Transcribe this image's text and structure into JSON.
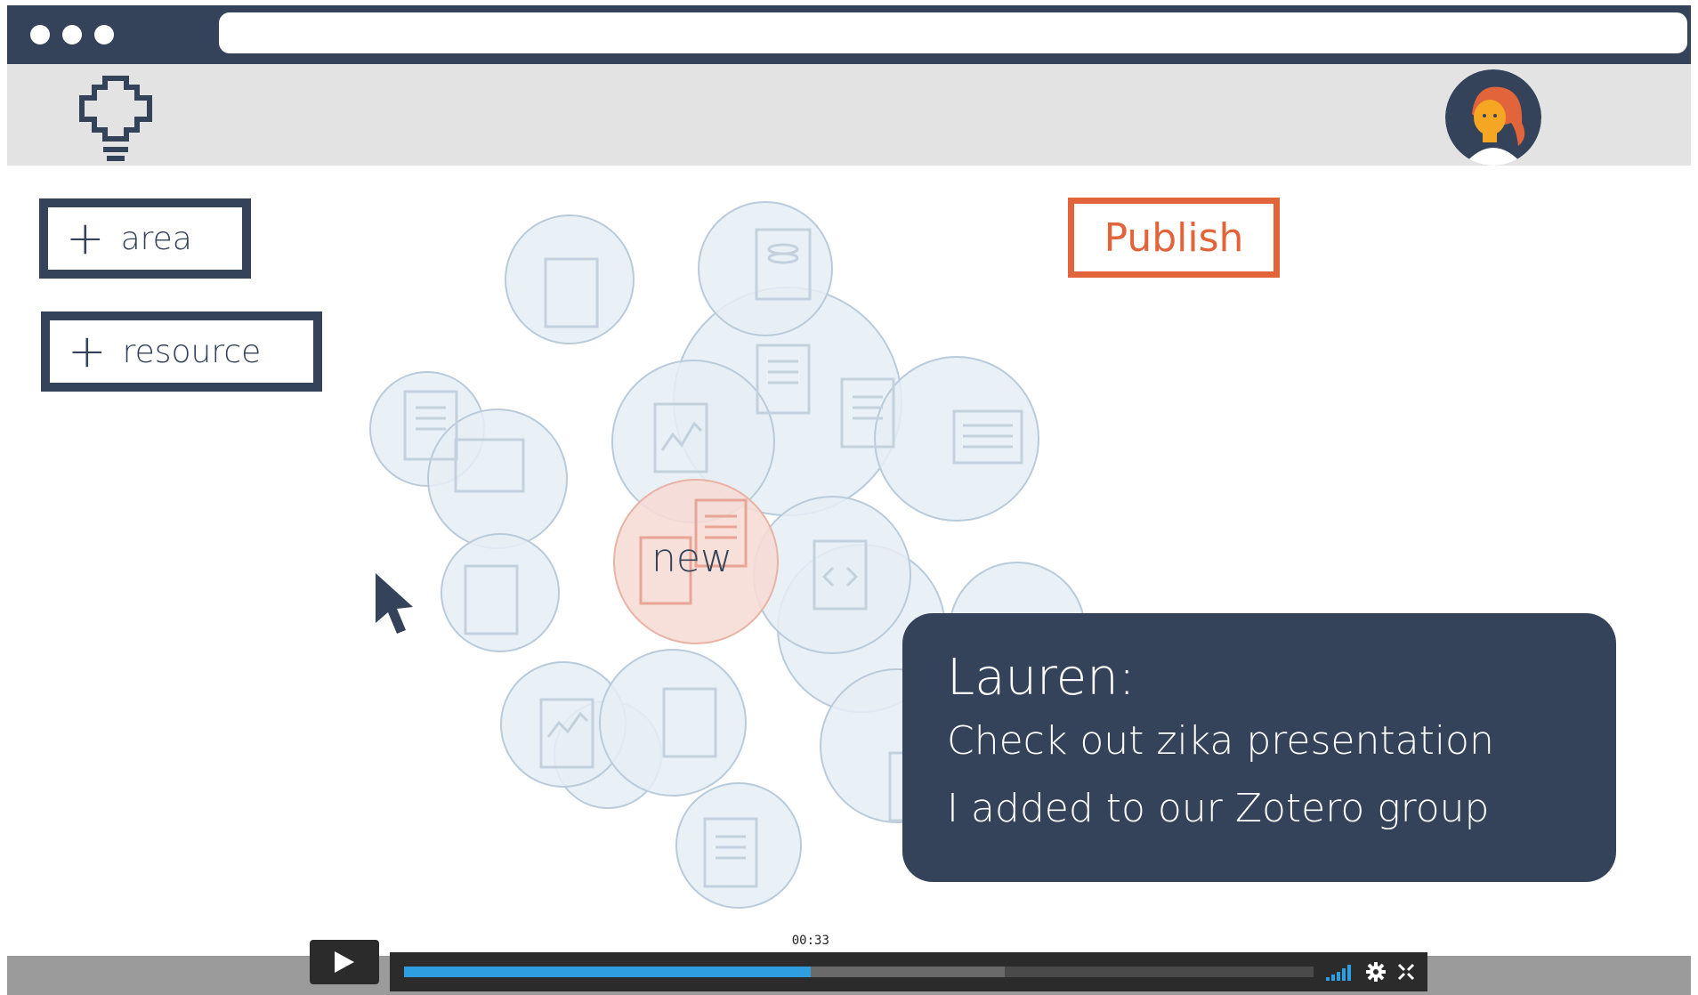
{
  "toolbar": {
    "add_area_plus": "+",
    "add_area_label": "area",
    "add_resource_plus": "+",
    "add_resource_label": "resource",
    "publish_label": "Publish"
  },
  "graph": {
    "new_node_label": "new"
  },
  "chat": {
    "sender": "Lauren:",
    "line1": "Check out zika presentation",
    "line2": "I added to our Zotero group"
  },
  "player": {
    "time": "00:33",
    "progress_fraction": 0.447,
    "loaded_fraction": 0.66,
    "play_icon": "play-icon",
    "volume_icon": "volume-icon",
    "settings_icon": "gear-icon",
    "fullscreen_icon": "fullscreen-icon"
  },
  "colors": {
    "navy": "#34435a",
    "accent_orange": "#e2643a",
    "bubble_fill": "#e6eef5",
    "bubble_stroke": "#b9cbdb",
    "new_bubble_fill": "#f6dcd6",
    "progress_blue": "#2e9ee0"
  }
}
